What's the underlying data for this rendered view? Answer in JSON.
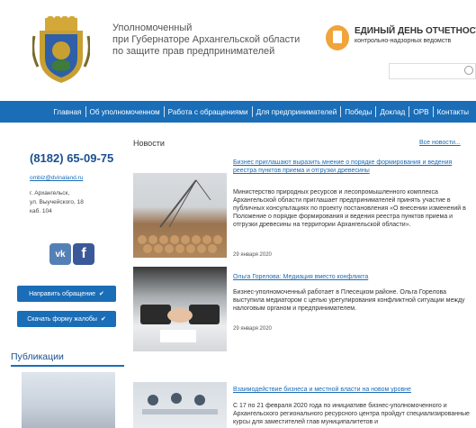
{
  "header": {
    "org_line1": "Уполномоченный",
    "org_line2": "при Губернаторе Архангельской области",
    "org_line3": "по защите прав предпринимателей",
    "edd_title": "ЕДИНЫЙ ДЕНЬ ОТЧЕТНОСТИ",
    "edd_sub": "контрольно-надзорных ведомств",
    "search_placeholder": ""
  },
  "nav": {
    "items": [
      "Главная",
      "Об уполномоченном",
      "Работа с обращениями",
      "Для предпринимателей",
      "Победы",
      "Доклад",
      "ОРВ",
      "Контакты"
    ]
  },
  "contact": {
    "phone": "(8182) 65-09-75",
    "email": "ombiz@dvinaland.ru",
    "addr1": "г. Архангельск,",
    "addr2": "ул. Выучейского, 18",
    "addr3": "каб. 104"
  },
  "social": {
    "vk": "vk",
    "fb": "f"
  },
  "buttons": {
    "send_request": "Направить обращение",
    "download_form": "Скачать форму жалобы"
  },
  "publications": {
    "heading": "Публикации"
  },
  "news": {
    "heading": "Новости",
    "all": "Все новости...",
    "items": [
      {
        "title": "Бизнес приглашают выразить мнение о порядке формирования и ведения реестра пунктов приема и отгрузки древесины",
        "text": "Министерство природных ресурсов и лесопромышленного комплекса Архангельской области приглашает предпринимателей принять участие в публичных консультациях по проекту постановления «О внесении изменений в Положение о порядке формирования и ведения реестра пунктов приема и отгрузки древесины на территории Архангельской области».",
        "date": "29 января 2020"
      },
      {
        "title": "Ольга Горелова: Медиация вместо конфликта",
        "text": "Бизнес-уполномоченный работает в Плесецком районе. Ольга Горелова выступила медиатором с целью урегулирования конфликтной ситуации между налоговым органом и предпринимателем.",
        "date": "29 января 2020"
      },
      {
        "title": "Взаимодействие бизнеса и местной власти на новом уровне",
        "text": "С 17 по 21 февраля 2020 года по инициативе бизнес-уполномоченного и Архангельского регионального ресурсного центра пройдут специализированные курсы для заместителей глав муниципалитетов и",
        "date": ""
      }
    ]
  },
  "colors": {
    "nav_bg": "#1a6db7",
    "accent": "#1a4f8f",
    "edd_icon": "#f0a43a"
  }
}
